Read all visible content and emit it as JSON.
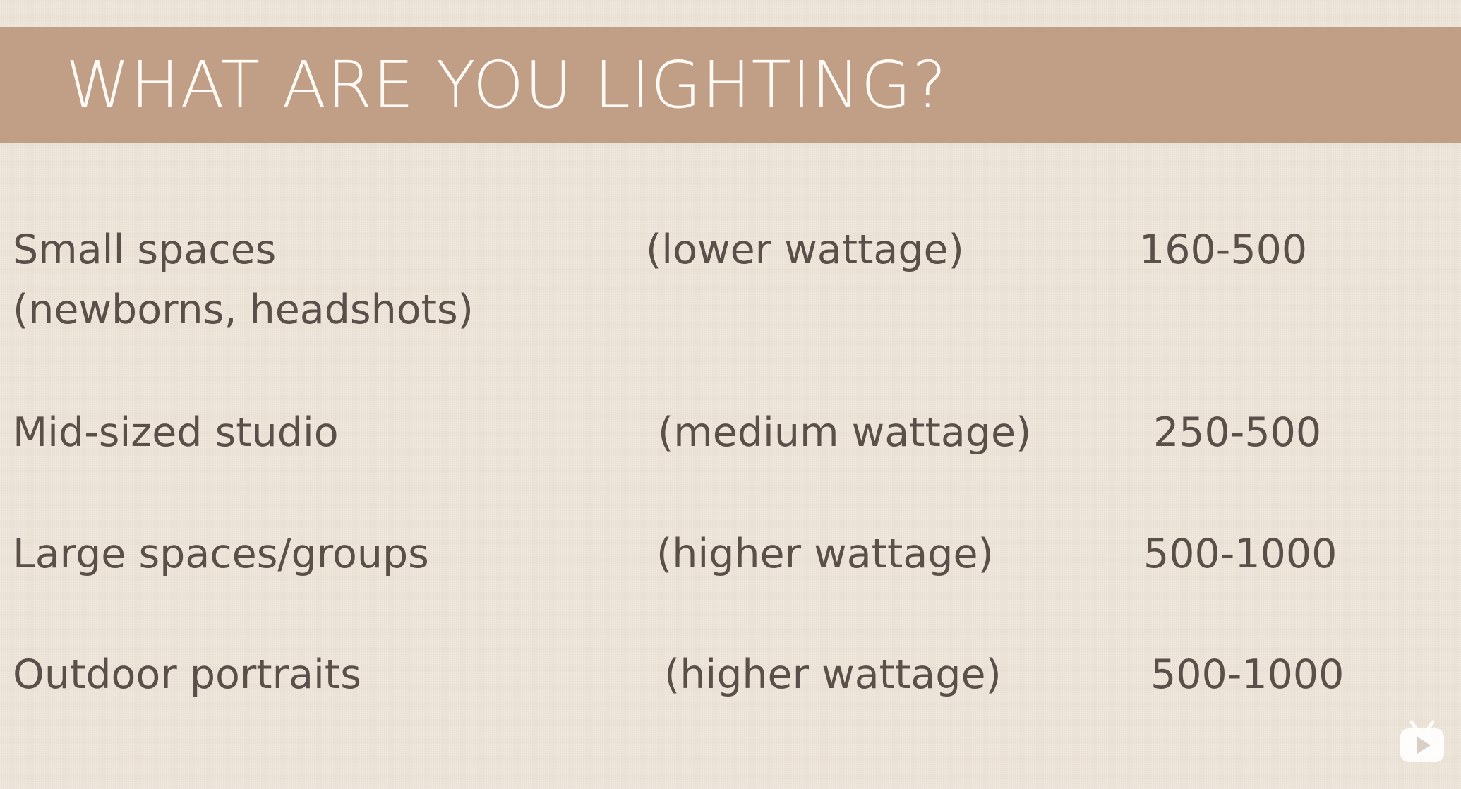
{
  "slide": {
    "title": "WHAT ARE YOU LIGHTING?",
    "rows": [
      {
        "label": "Small spaces",
        "sublabel": "(newborns, headshots)",
        "wattage": "(lower wattage)",
        "range": "160-500"
      },
      {
        "label": "Mid-sized studio",
        "wattage": "(medium wattage)",
        "range": "250-500"
      },
      {
        "label": "Large spaces/groups",
        "wattage": "(higher wattage)",
        "range": "500-1000"
      },
      {
        "label": "Outdoor portraits",
        "wattage": "(higher wattage)",
        "range": "500-1000"
      }
    ]
  },
  "overlay": {
    "icon": "video-play-icon"
  },
  "colors": {
    "background": "#efe6da",
    "title_bar": "#c09f86",
    "title_text": "#fffaf5",
    "body_text": "#5b4f49",
    "icon": "#ffffff"
  }
}
